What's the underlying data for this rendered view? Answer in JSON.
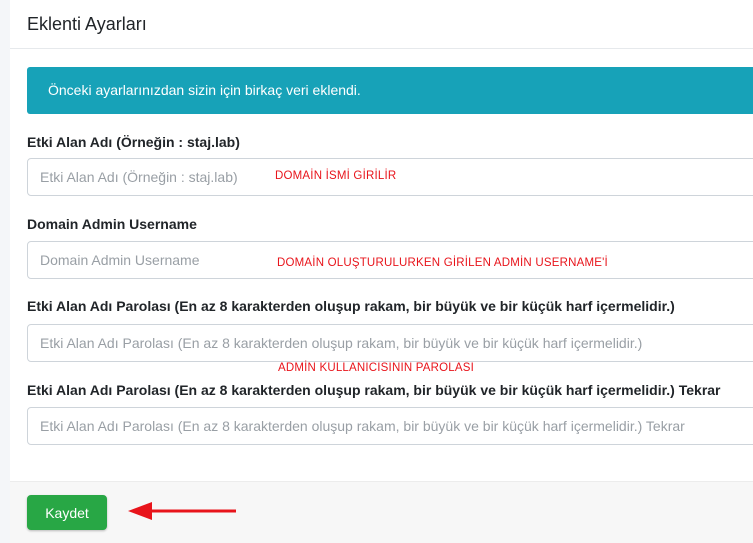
{
  "header": {
    "title": "Eklenti Ayarları"
  },
  "alert": {
    "text": "Önceki ayarlarınızdan sizin için birkaç veri eklendi."
  },
  "fields": [
    {
      "label": "Etki Alan Adı (Örneğin : staj.lab)",
      "placeholder": "Etki Alan Adı (Örneğin : staj.lab)",
      "value": "",
      "annotation": "DOMAİN İSMİ GİRİLİR"
    },
    {
      "label": "Domain Admin Username",
      "placeholder": "Domain Admin Username",
      "value": "",
      "annotation": "DOMAİN OLUŞTURULURKEN GİRİLEN ADMİN USERNAME'İ"
    },
    {
      "label": "Etki Alan Adı Parolası (En az 8 karakterden oluşup rakam, bir büyük ve bir küçük harf içermelidir.)",
      "placeholder": "Etki Alan Adı Parolası (En az 8 karakterden oluşup rakam, bir büyük ve bir küçük harf içermelidir.)",
      "value": "",
      "annotation": "ADMİN KULLANICISININ PAROLASI"
    },
    {
      "label": "Etki Alan Adı Parolası (En az 8 karakterden oluşup rakam, bir büyük ve bir küçük harf içermelidir.) Tekrar",
      "placeholder": "Etki Alan Adı Parolası (En az 8 karakterden oluşup rakam, bir büyük ve bir küçük harf içermelidir.) Tekrar",
      "value": ""
    }
  ],
  "footer": {
    "save_label": "Kaydet"
  },
  "colors": {
    "alert_bg": "#17a2b8",
    "save_bg": "#28a745",
    "annotation": "#e8141b"
  },
  "icons": {
    "pointer_arrow": "left-arrow-icon"
  }
}
